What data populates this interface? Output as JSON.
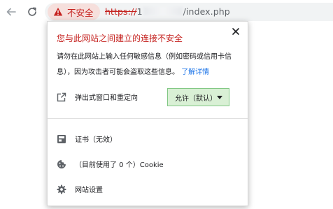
{
  "browser": {
    "security_label": "不安全",
    "url": {
      "scheme": "https://",
      "host_visible": "1",
      "path": "/index.php"
    }
  },
  "popup": {
    "title": "您与此网站之间建立的连接不安全",
    "description": "请勿在此网站上输入任何敏感信息（例如密码或信用卡信息），因为攻击者可能会盗取这些信息。",
    "learn_more": "了解详情",
    "popups_row": {
      "label": "弹出式窗口和重定向",
      "select_value": "允许（默认）"
    },
    "certificate_row": {
      "label": "证书（无效）"
    },
    "cookie_row": {
      "label": "（目前使用了 0 个）Cookie"
    },
    "site_settings_row": {
      "label": "网站设置"
    }
  },
  "colors": {
    "danger": "#c5221f",
    "link": "#1a73e8",
    "select_bg": "#d9f0d5"
  },
  "icons": [
    "back-arrow-icon",
    "reload-icon",
    "warning-triangle-icon",
    "close-icon",
    "external-link-icon",
    "certificate-icon",
    "cookie-icon",
    "gear-icon"
  ]
}
